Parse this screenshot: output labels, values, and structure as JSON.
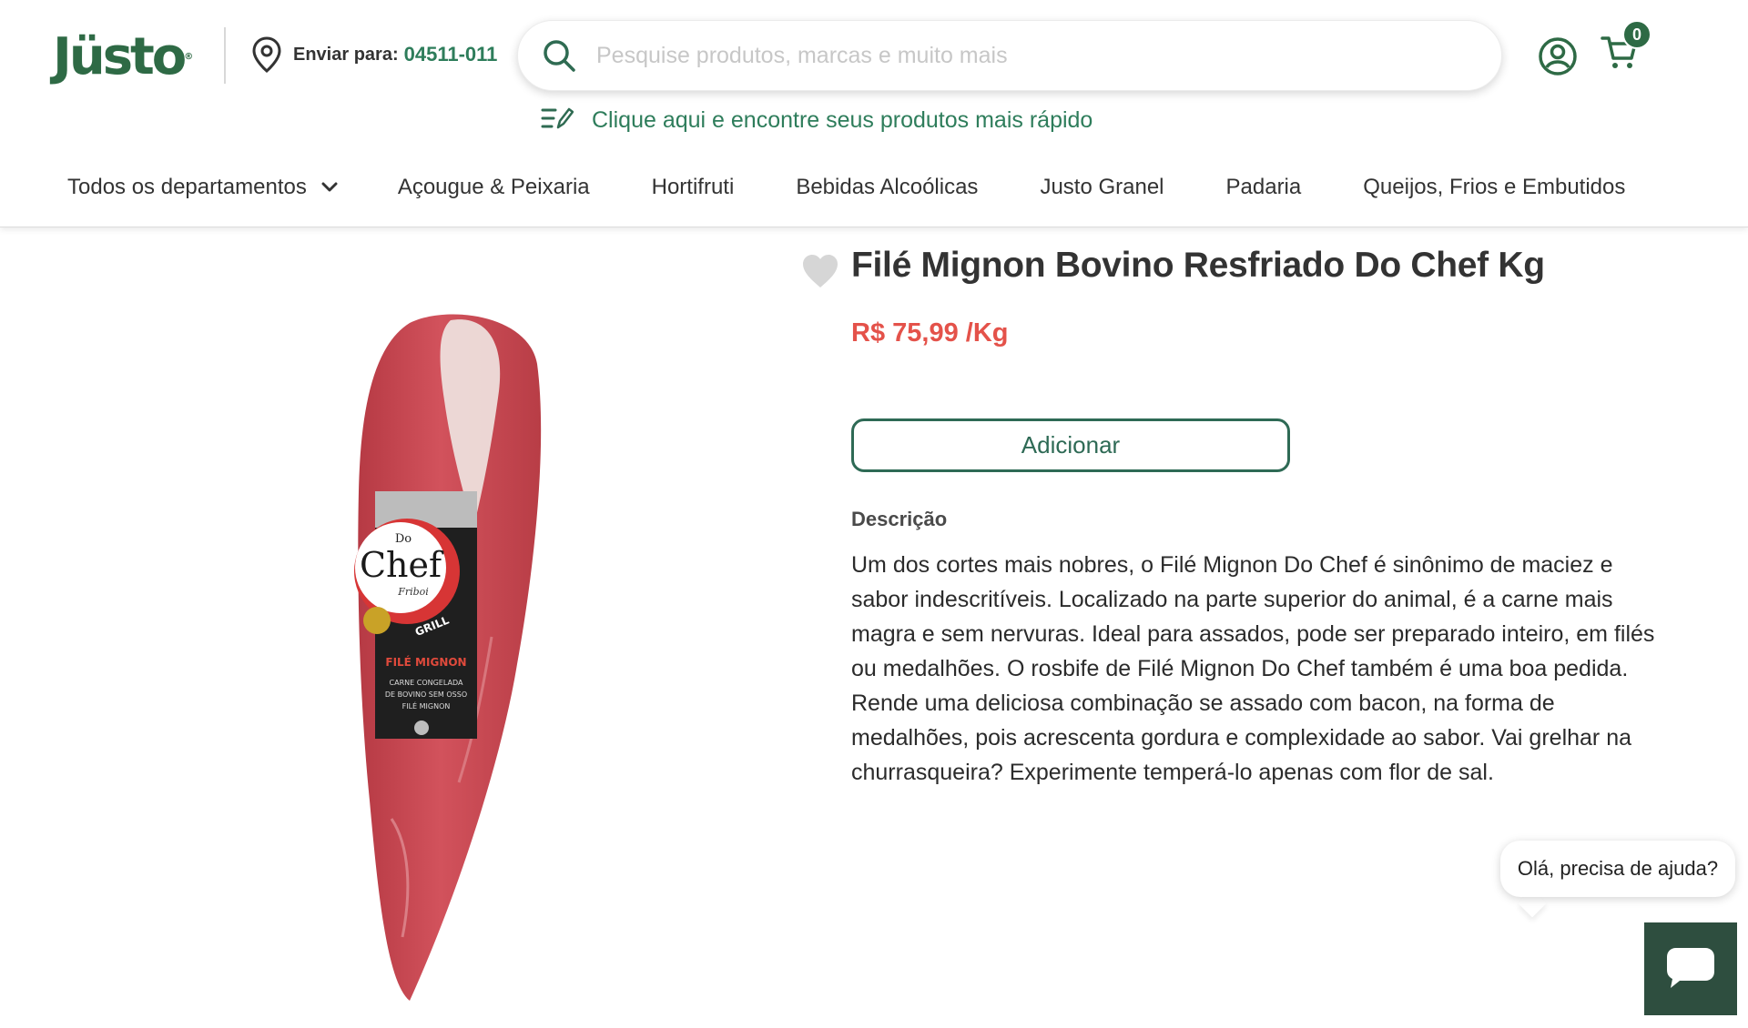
{
  "brand": {
    "logo_text": "Jüsto",
    "logo_reg": "®",
    "color": "#2e6a45"
  },
  "shipping": {
    "label": "Enviar para:",
    "cep": "04511-011",
    "icon": "location-pin-icon"
  },
  "search": {
    "placeholder": "Pesquise produtos, marcas e muito mais",
    "value": "",
    "icon": "search-icon"
  },
  "header_actions": {
    "user_icon": "user-circle-icon",
    "cart_icon": "cart-icon",
    "cart_count": "0"
  },
  "quick_shop": {
    "text": "Clique aqui e encontre seus produtos mais rápido",
    "icon": "list-edit-icon"
  },
  "nav": {
    "departments_label": "Todos os departamentos",
    "items": [
      {
        "label": "Açougue & Peixaria"
      },
      {
        "label": "Hortifruti"
      },
      {
        "label": "Bebidas Alcoólicas"
      },
      {
        "label": "Justo Granel"
      },
      {
        "label": "Padaria"
      },
      {
        "label": "Queijos, Frios e Embutidos"
      }
    ]
  },
  "product": {
    "title": "Filé Mignon Bovino Resfriado Do Chef Kg",
    "price": "R$ 75,99 /Kg",
    "add_label": "Adicionar",
    "description_label": "Descrição",
    "description": "Um dos cortes mais nobres, o Filé Mignon Do Chef é sinônimo de maciez e sabor indescritíveis. Localizado na parte superior do animal, é a carne mais magra e sem nervuras. Ideal para assados, pode ser preparado inteiro, em filés ou medalhões. O rosbife de Filé Mignon Do Chef também é uma boa pedida. Rende uma deliciosa combinação se assado com bacon, na forma de medalhões, pois acrescenta gordura e complexidade ao sabor. Vai grelhar na churrasqueira? Experimente temperá-lo apenas com flor de sal.",
    "package": {
      "brand_top": "Do",
      "brand_main": "Chef",
      "brand_sub": "Friboi",
      "badge": "GRILL",
      "cut": "FILÉ MIGNON",
      "line1": "CARNE CONGELADA",
      "line2": "DE BOVINO SEM OSSO",
      "line3": "FILÉ MIGNON"
    },
    "favorite_icon": "heart-icon",
    "price_color": "#e4524a"
  },
  "help": {
    "bubble_text": "Olá, precisa de ajuda?",
    "button_icon": "chat-icon"
  }
}
